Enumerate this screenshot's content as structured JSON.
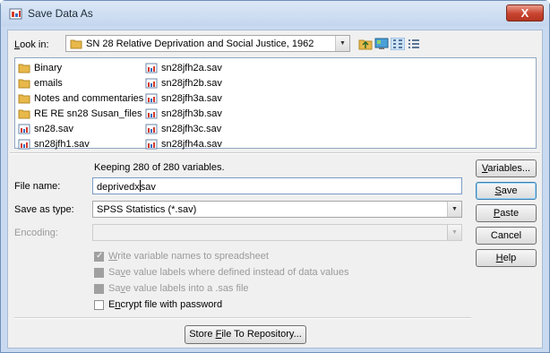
{
  "window": {
    "title": "Save Data As",
    "close_label": "X"
  },
  "lookin": {
    "label": "Look in:",
    "label_key": "L",
    "label_rest": "ook in:",
    "folder": "SN 28 Relative Deprivation and Social Justice, 1962"
  },
  "files": [
    {
      "name": "Binary",
      "type": "folder"
    },
    {
      "name": "emails",
      "type": "folder"
    },
    {
      "name": "Notes and commentaries",
      "type": "folder"
    },
    {
      "name": "RE RE sn28 Susan_files",
      "type": "folder"
    },
    {
      "name": "sn28.sav",
      "type": "sav"
    },
    {
      "name": "sn28jfh1.sav",
      "type": "sav"
    },
    {
      "name": "sn28jfh2a.sav",
      "type": "sav"
    },
    {
      "name": "sn28jfh2b.sav",
      "type": "sav"
    },
    {
      "name": "sn28jfh3a.sav",
      "type": "sav"
    },
    {
      "name": "sn28jfh3b.sav",
      "type": "sav"
    },
    {
      "name": "sn28jfh3c.sav",
      "type": "sav"
    },
    {
      "name": "sn28jfh4a.sav",
      "type": "sav"
    }
  ],
  "keeping_text": "Keeping 280 of 280 variables.",
  "filename": {
    "label": "File name:",
    "value_before_caret": "deprivedx",
    "value_after_caret": "sav"
  },
  "savetype": {
    "label": "Save as type:",
    "value": "SPSS Statistics (*.sav)"
  },
  "encoding": {
    "label": "Encoding:",
    "value": ""
  },
  "options": {
    "write_names": {
      "key": "W",
      "rest": "rite variable names to spreadsheet",
      "checked": true,
      "enabled": false
    },
    "save_labels": {
      "pre": "Sa",
      "key": "v",
      "rest": "e value labels where defined instead of data values",
      "checked": false,
      "enabled": false
    },
    "sas_file": {
      "pre": "Sa",
      "key": "v",
      "rest": "e value labels into a .sas file",
      "checked": false,
      "enabled": false
    },
    "encrypt": {
      "pre": "E",
      "key": "n",
      "rest": "crypt file with password",
      "checked": false,
      "enabled": true
    }
  },
  "buttons": {
    "variables": {
      "key": "V",
      "rest": "ariables..."
    },
    "save": {
      "key": "S",
      "rest": "ave"
    },
    "paste": {
      "key": "P",
      "rest": "aste"
    },
    "cancel": {
      "label": "Cancel"
    },
    "help": {
      "key": "H",
      "rest": "elp"
    },
    "store": {
      "pre": "Store ",
      "key": "F",
      "rest": "ile To Repository..."
    }
  },
  "colors": {
    "title_bar": "#c4d6ee",
    "close_button": "#c8442f",
    "dialog_background": "#f0f0f0",
    "selection_border": "#7a9cc5"
  }
}
